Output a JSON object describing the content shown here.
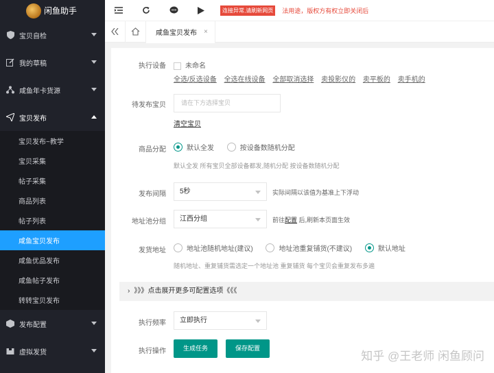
{
  "app": {
    "title": "闲鱼助手"
  },
  "sidebar": {
    "items": [
      {
        "label": "宝贝自检"
      },
      {
        "label": "我的草稿"
      },
      {
        "label": "咸鱼年卡货源"
      },
      {
        "label": "宝贝发布"
      },
      {
        "label": "发布配置"
      },
      {
        "label": "虚拟发货"
      }
    ],
    "sub_items": [
      {
        "label": "宝贝发布~教学"
      },
      {
        "label": "宝贝采集"
      },
      {
        "label": "帖子采集"
      },
      {
        "label": "商品列表"
      },
      {
        "label": "帖子列表"
      },
      {
        "label": "咸鱼宝贝发布"
      },
      {
        "label": "咸鱼优品发布"
      },
      {
        "label": "咸鱼帖子发布"
      },
      {
        "label": "转转宝贝发布"
      }
    ]
  },
  "topbar": {
    "badge": "连接异常,请刷新网页",
    "warning": "法用途，版权方有权立即关闭后"
  },
  "tabs": {
    "active": "咸鱼宝贝发布",
    "close": "×"
  },
  "form": {
    "device": {
      "label": "执行设备",
      "checkbox_label": "未命名",
      "links": [
        "全选/反选设备",
        "全选在线设备",
        "全部取消选择",
        "卖投影仪的",
        "卖平板的",
        "卖手机的"
      ]
    },
    "pending": {
      "label": "待发布宝贝",
      "placeholder": "请在下方选择宝贝",
      "clear": "清空宝贝"
    },
    "distribution": {
      "label": "商品分配",
      "options": [
        "默认全发",
        "按设备数随机分配"
      ],
      "help": "默认全发 所有宝贝全部设备都发,随机分配 按设备数随机分配"
    },
    "interval": {
      "label": "发布间隔",
      "value": "5秒",
      "help": "实际间隔以该值为基准上下浮动"
    },
    "address_group": {
      "label": "地址池分组",
      "value": "江西分组",
      "help_prefix": "前往",
      "help_link": "配置",
      "help_suffix": " 后,刷新本页面生效"
    },
    "ship_address": {
      "label": "发货地址",
      "options": [
        "地址池随机地址(建议)",
        "地址池重复铺货(不建议)",
        "默认地址"
      ],
      "help": "随机地址、重复铺货需选定一个地址池  重复铺货 每个宝贝会重复发布多遍"
    },
    "expand": "》》》点击展开更多可配置选项《《《",
    "frequency": {
      "label": "执行频率",
      "value": "立即执行"
    },
    "action": {
      "label": "执行操作",
      "generate": "生成任务",
      "save": "保存配置"
    }
  },
  "watermark": "知乎 @王老师 闲鱼顾问",
  "colors": {
    "accent": "#009688",
    "sidebar_bg": "#20222a",
    "active_item": "#1e9fff",
    "badge": "#e64a3b"
  }
}
